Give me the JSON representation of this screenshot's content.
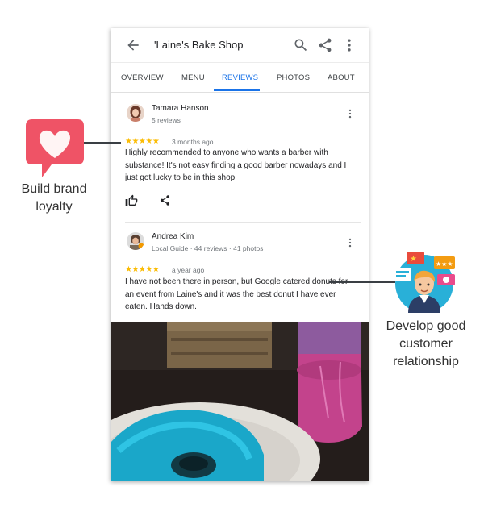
{
  "app": {
    "title": "'Laine's Bake Shop",
    "icons": {
      "back": "arrow-back-icon",
      "search": "search-icon",
      "share": "share-icon",
      "more": "more-vert-icon"
    }
  },
  "tabs": [
    {
      "label": "OVERVIEW",
      "active": false
    },
    {
      "label": "MENU",
      "active": false
    },
    {
      "label": "REVIEWS",
      "active": true
    },
    {
      "label": "PHOTOS",
      "active": false
    },
    {
      "label": "ABOUT",
      "active": false
    }
  ],
  "reviews": [
    {
      "name": "Tamara Hanson",
      "meta": "5 reviews",
      "rating": 5,
      "stars": "★★★★★",
      "time": "3 months ago",
      "text": "Highly recommended to anyone who wants a barber with substance! It's not easy finding a good barber nowadays and I just got lucky to be in this shop."
    },
    {
      "name": "Andrea Kim",
      "meta": "Local Guide · 44 reviews · 41 photos",
      "rating": 5,
      "stars": "★★★★★",
      "time": "a year ago",
      "text": "I have not been there in person, but Google catered donuts for an event from Laine's and it was the best donut I have ever eaten. Hands down."
    }
  ],
  "annotations": {
    "left": {
      "line1": "Build brand",
      "line2": "loyalty",
      "icon": "heart-speech-bubble-icon"
    },
    "right": {
      "line1": "Develop good",
      "line2": "customer",
      "line3": "relationship",
      "icon": "customer-feedback-icon"
    }
  },
  "colors": {
    "accent": "#1a73e8",
    "star": "#fbbc04",
    "heart_bubble": "#ef5366"
  }
}
